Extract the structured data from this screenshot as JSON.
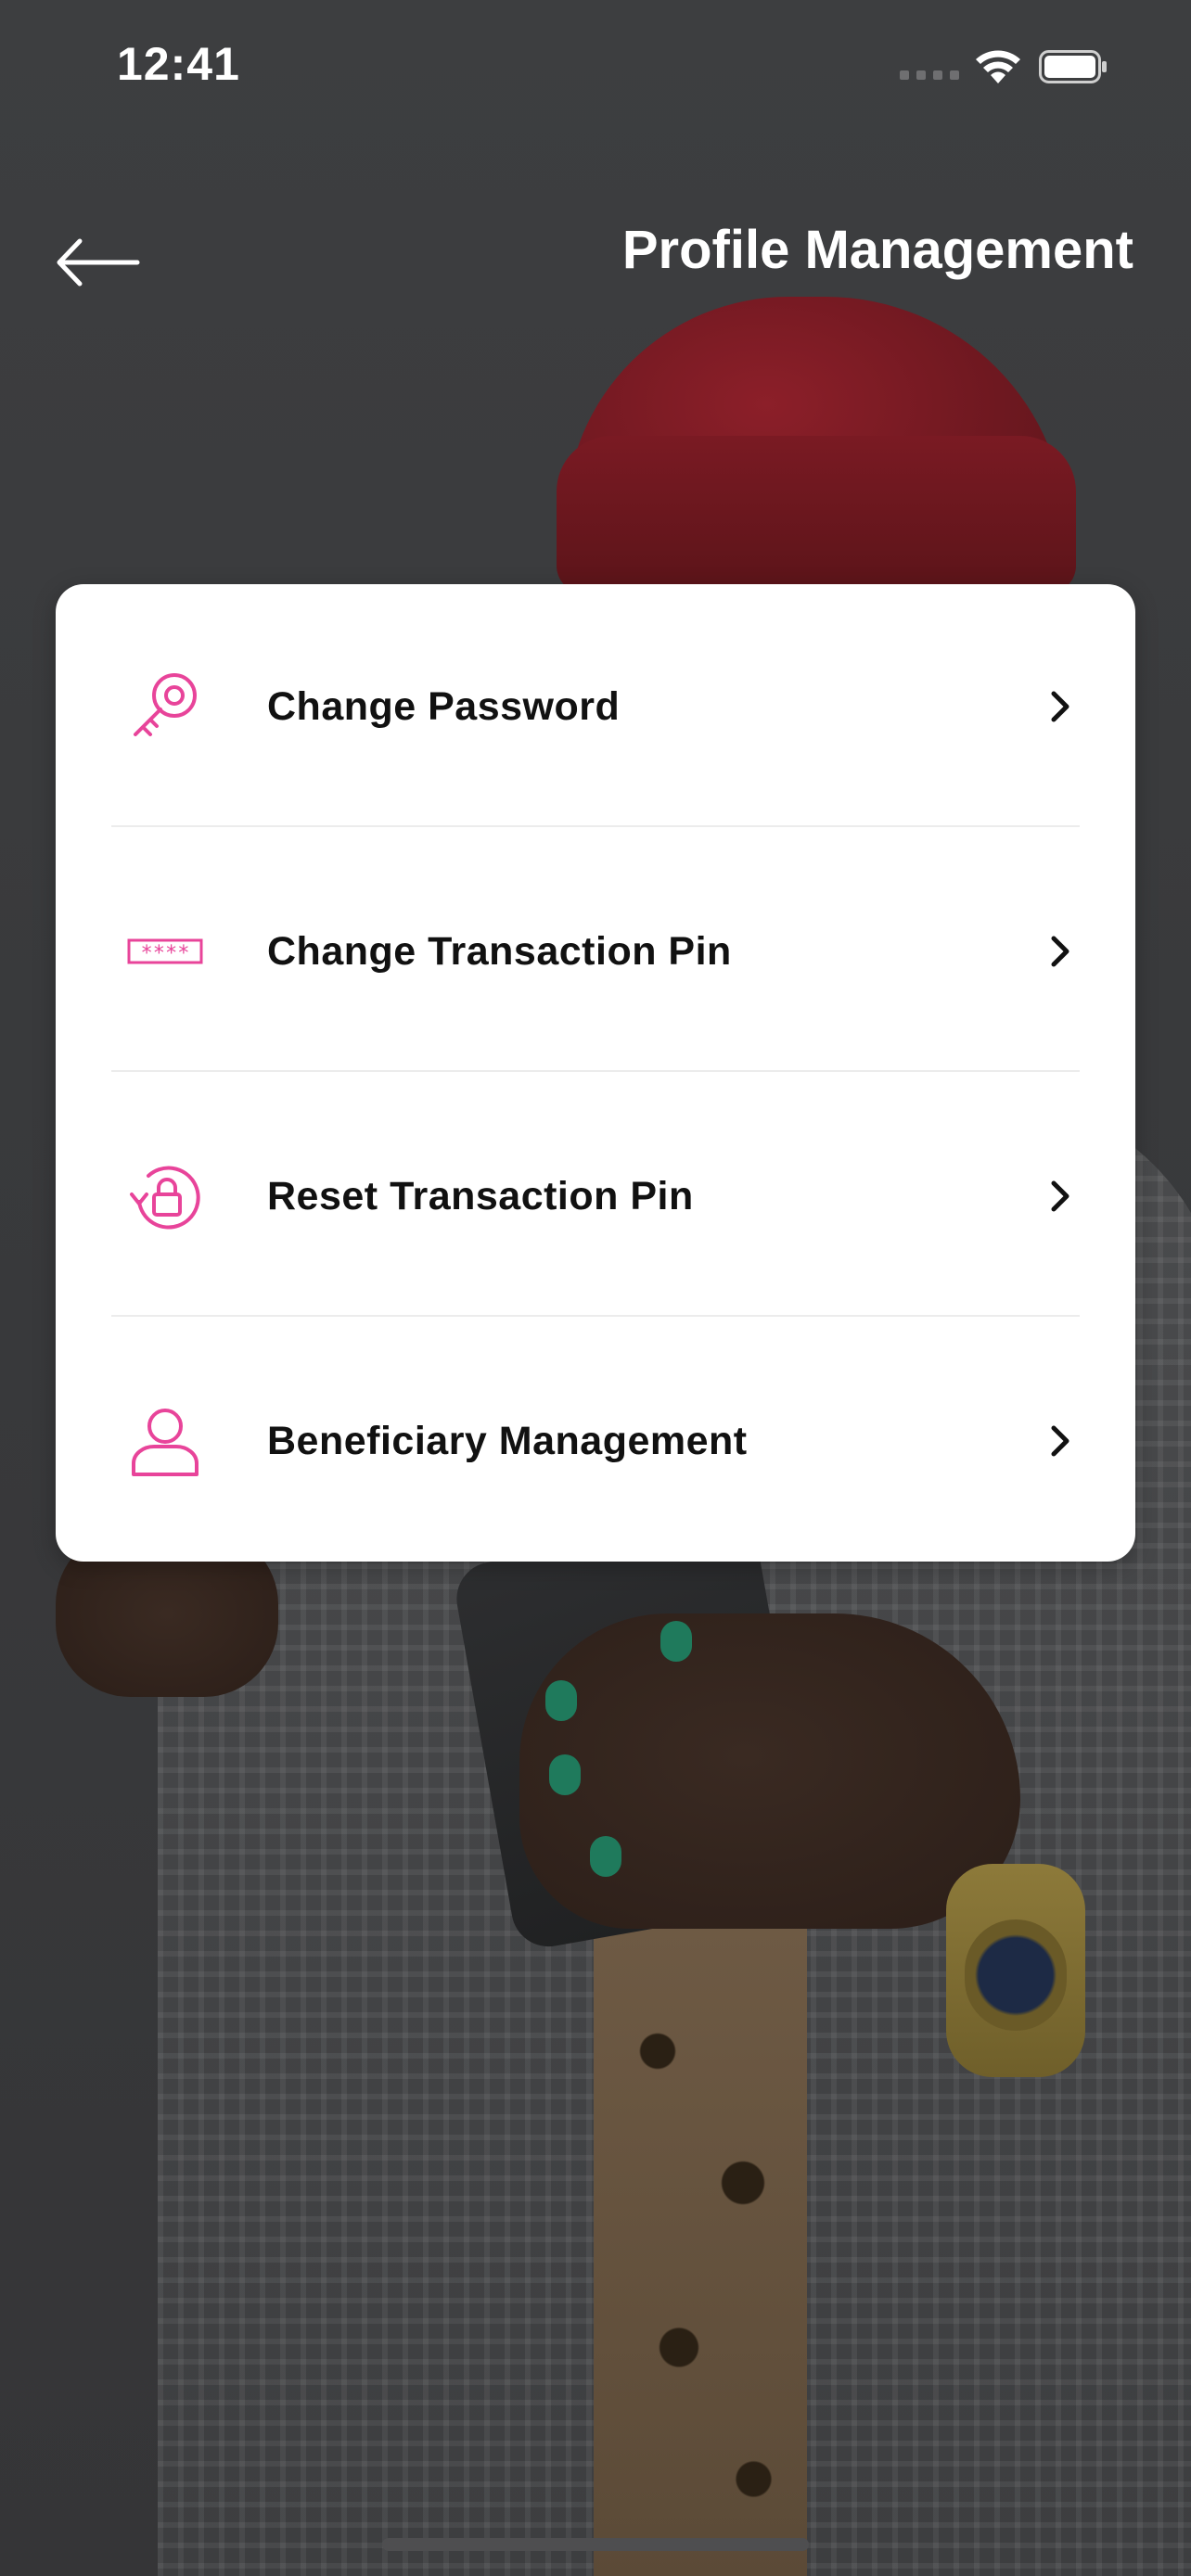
{
  "status_bar": {
    "time": "12:41"
  },
  "header": {
    "title": "Profile Management",
    "back_icon": "arrow-left-icon"
  },
  "menu": {
    "items": [
      {
        "label": "Change Password",
        "icon": "key-icon"
      },
      {
        "label": "Change Transaction Pin",
        "icon": "pin-field-icon"
      },
      {
        "label": "Reset Transaction Pin",
        "icon": "reset-lock-icon"
      },
      {
        "label": "Beneficiary Management",
        "icon": "person-icon"
      }
    ]
  },
  "colors": {
    "accent": "#e8449a",
    "card_background": "#ffffff",
    "text_primary": "#111111",
    "title_text": "#ffffff"
  }
}
